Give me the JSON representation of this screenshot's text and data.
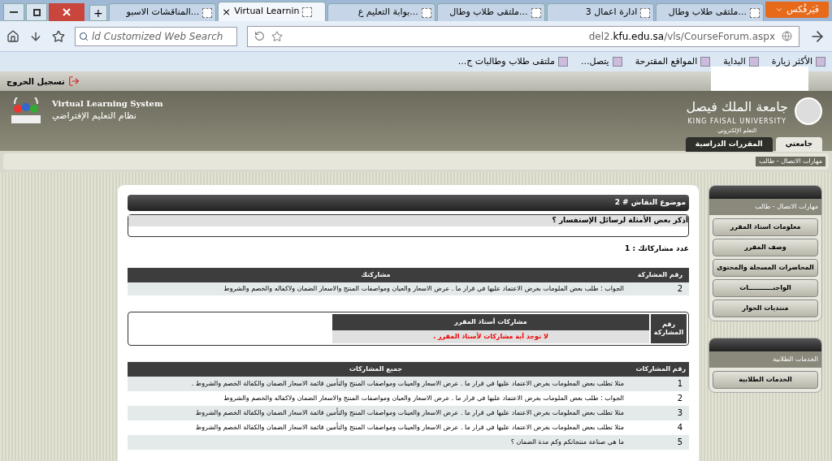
{
  "browser": {
    "menu_button": "فَيَرفُكس",
    "tabs": [
      {
        "label": "ملتقى طلاب وطال...",
        "selected": false
      },
      {
        "label": "ادارة اعمال 3",
        "selected": false
      },
      {
        "label": "ملتقى طلاب وطال...",
        "selected": false
      },
      {
        "label": "بوابة التعليم ع...",
        "selected": false
      },
      {
        "label": "Virtual Learnin",
        "selected": true
      },
      {
        "label": "المناقشات الاسبو...",
        "selected": false
      }
    ],
    "new_tab": "+",
    "close_tab": "×",
    "search": {
      "placeholder": "ld Customized Web Search"
    },
    "url": {
      "prefix": "del2.",
      "domain": "kfu.edu.sa",
      "path": "/vls/CourseForum.aspx"
    },
    "bookmarks": [
      "الأكثر زيارة",
      "البداية",
      "المواقع المقترحة",
      "يتصل...",
      "ملتقى طلاب وطالبات ج..."
    ]
  },
  "site": {
    "logout": "تسجيل الخروج",
    "system_en": "Virtual Learning System",
    "system_ar": "نظام التعليم الإفتراضي",
    "university_ar": "جامعة الملك فيصل",
    "university_en": "KING FAISAL UNIVERSITY",
    "university_sub": "التعلم الإلكتروني",
    "nav_tabs": [
      {
        "label": "جامعتي",
        "selected": true
      },
      {
        "label": "المقررات الدراسية",
        "selected": false
      }
    ],
    "breadcrumb": "مهارات الاتصال - طالب"
  },
  "topic": {
    "title": "موضوع النقاش # 2",
    "question": "أذكر بعض الأمثلة لرسائل الإستفسار ؟",
    "count_label": "عدد مشاركاتك : 1"
  },
  "my_posts": {
    "columns": [
      "رقم المشاركة",
      "مشاركتك"
    ],
    "rows": [
      {
        "number": "2",
        "text": "الجواب : طلب بعض الملومات بغرض الاعتماد عليها في قرار ما . عرض الاسعار والعيان ومواصفات المنتج والاسعار الضمان ولاكفاله والخصم والشروط"
      }
    ]
  },
  "instructor_posts": {
    "columns": [
      "رقم المشاركة",
      "مشاركات أستاذ المقرر"
    ],
    "empty": "لا توجد أية مشاركات لأستاذ المقرر ."
  },
  "all_posts": {
    "columns": [
      "رقم المشاركات",
      "جميع المشاركات"
    ],
    "rows": [
      {
        "number": "1",
        "text": "مثلا تطلب بعض المعلومات بغرض الاعتماد عليها في قرار ما . عرض الاسعار والعينات ومواصفات المنتج والتأمين قائمة الاسعار الضمان والكفالة الخصم والشروط ."
      },
      {
        "number": "2",
        "text": "الجواب : طلب بعض الملومات بغرض الاعتماد عليها في قرار ما . عرض الاسعار والعيان ومواصفات المنتج والاسعار الضمان ولاكفاله والخصم والشروط"
      },
      {
        "number": "3",
        "text": "مثلا تطلب بعض المعلومات بغرض الاعتماد عليها في قرار ما . عرض الاسعار والعينات ومواصفات المنتج والتأمين قائمة الاسعار الضمان والكفالة الخصم والشروط"
      },
      {
        "number": "4",
        "text": "مثلا تطلب بعض المعلومات بغرض الاعتماد عليها في قرار ما . عرض الاسعار والعينات ومواصفات المنتج والتأمين قائمة الاسعار الضمان والكفالة الخصم والشروط"
      },
      {
        "number": "5",
        "text": "ما هي صناعة منتجاتكم وكم مدة الضمان ؟"
      }
    ]
  },
  "side_panels": [
    {
      "title": "مهارات الاتصال - طالب",
      "items": [
        "معلومات استاذ المقرر",
        "وصف المقرر",
        "المحاضرات المسجلة والمحتوى",
        "الواجبـــــــــــات",
        "منتديات الحوار"
      ]
    },
    {
      "title": "الخدمات الطلابية",
      "items": [
        "الخدمات الطلابية"
      ]
    }
  ]
}
